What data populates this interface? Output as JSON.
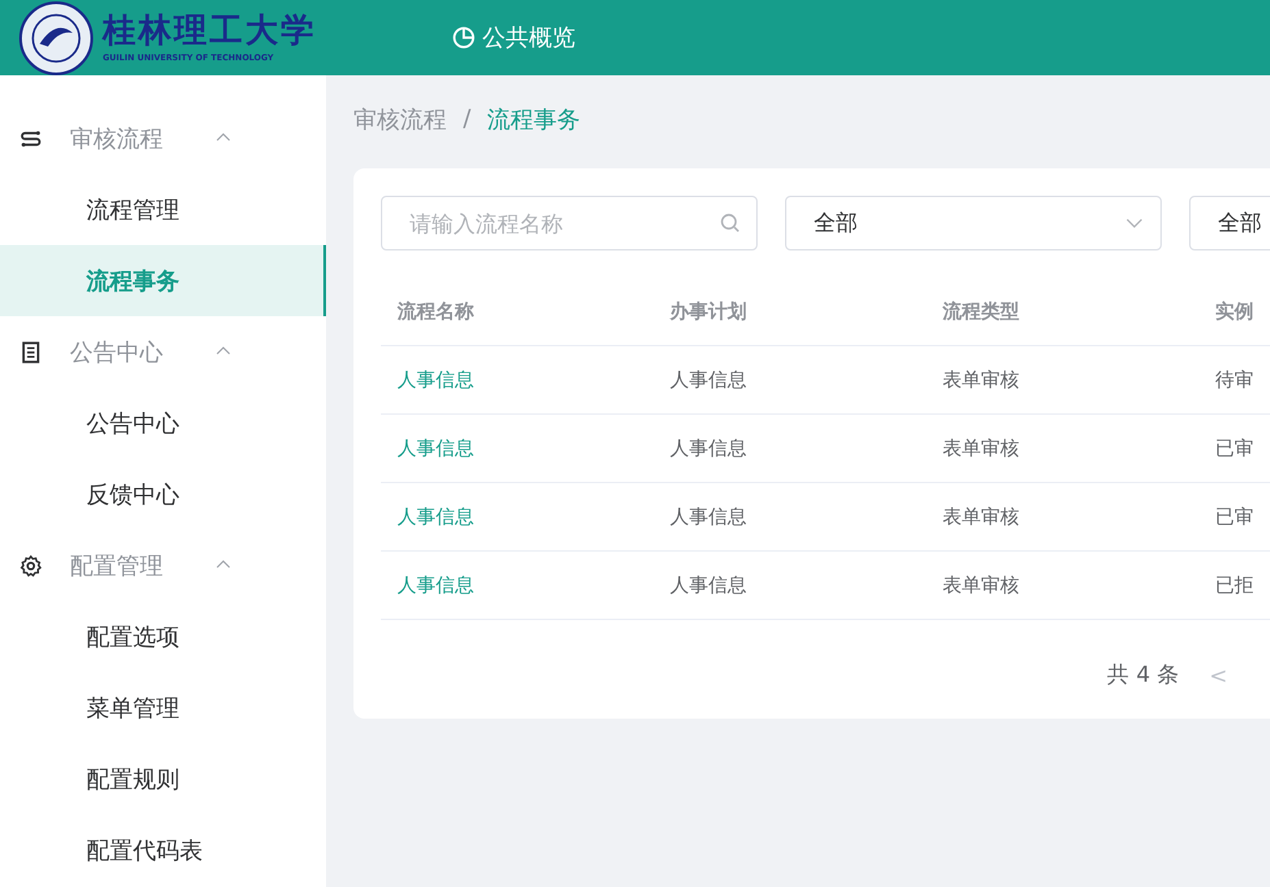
{
  "header": {
    "logo_title": "桂林理工大学",
    "logo_subtitle": "GUILIN UNIVERSITY OF TECHNOLOGY",
    "nav": [
      {
        "label": "公共概览",
        "selected": false
      }
    ]
  },
  "sidebar": {
    "groups": [
      {
        "label": "审核流程",
        "expanded": true,
        "children": [
          {
            "label": "流程管理",
            "selected": false
          },
          {
            "label": "流程事务",
            "selected": true
          }
        ]
      },
      {
        "label": "公告中心",
        "expanded": true,
        "children": [
          {
            "label": "公告中心",
            "selected": false
          },
          {
            "label": "反馈中心",
            "selected": false
          }
        ]
      },
      {
        "label": "配置管理",
        "expanded": true,
        "children": [
          {
            "label": "配置选项",
            "selected": false
          },
          {
            "label": "菜单管理",
            "selected": false
          },
          {
            "label": "配置规则",
            "selected": false
          },
          {
            "label": "配置代码表",
            "selected": false
          }
        ]
      }
    ]
  },
  "breadcrumb": {
    "items": [
      "审核流程",
      "流程事务"
    ],
    "separator": "/"
  },
  "filters": {
    "search": {
      "placeholder": "请输入流程名称"
    },
    "selects": [
      {
        "value": "全部"
      },
      {
        "value": "全部"
      }
    ]
  },
  "table": {
    "columns": [
      "流程名称",
      "办事计划",
      "流程类型",
      "实例"
    ],
    "rows": [
      [
        "人事信息",
        "人事信息",
        "表单审核",
        "待审"
      ],
      [
        "人事信息",
        "人事信息",
        "表单审核",
        "已审"
      ],
      [
        "人事信息",
        "人事信息",
        "表单审核",
        "已审"
      ],
      [
        "人事信息",
        "人事信息",
        "表单审核",
        "已拒"
      ]
    ]
  },
  "pagination": {
    "total": "共 4 条",
    "prev": "<"
  }
}
